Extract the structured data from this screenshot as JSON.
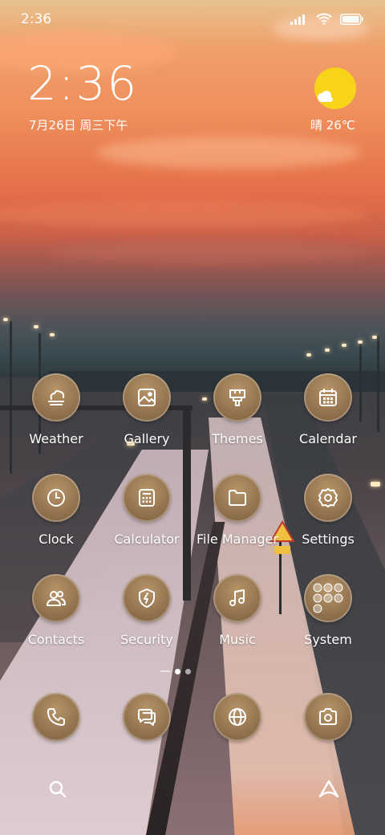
{
  "status_bar": {
    "time": "2:36"
  },
  "clock_widget": {
    "time": "2:36",
    "date": "7月26日 周三下午"
  },
  "weather_widget": {
    "text": "晴 26℃",
    "icon": "sun-with-cloud-icon"
  },
  "apps": [
    {
      "label": "Weather",
      "icon": "weather-icon"
    },
    {
      "label": "Gallery",
      "icon": "gallery-icon"
    },
    {
      "label": "Themes",
      "icon": "themes-icon"
    },
    {
      "label": "Calendar",
      "icon": "calendar-icon"
    },
    {
      "label": "Clock",
      "icon": "clock-icon"
    },
    {
      "label": "Calculator",
      "icon": "calculator-icon"
    },
    {
      "label": "File Manager",
      "icon": "folder-icon"
    },
    {
      "label": "Settings",
      "icon": "gear-icon"
    },
    {
      "label": "Contacts",
      "icon": "contacts-icon"
    },
    {
      "label": "Security",
      "icon": "shield-icon"
    },
    {
      "label": "Music",
      "icon": "music-note-icon"
    },
    {
      "label": "System",
      "icon": "folder-grid-icon"
    }
  ],
  "dock": [
    {
      "icon": "phone-icon"
    },
    {
      "icon": "messages-icon"
    },
    {
      "icon": "browser-icon"
    },
    {
      "icon": "camera-icon"
    }
  ],
  "colors": {
    "icon_bg": "#8c6d4a",
    "sun": "#f7d31a",
    "text": "#ffffff"
  }
}
